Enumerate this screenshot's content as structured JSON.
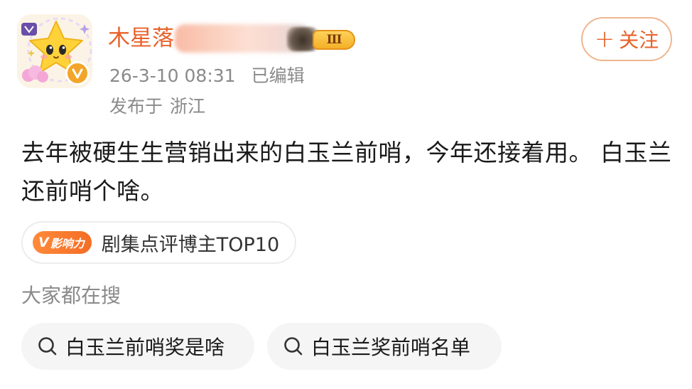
{
  "author": {
    "name_visible": "木星落",
    "level_badge": "III",
    "avatar_icon": "star-mascot-avatar",
    "verified_icon": "verified-v-icon"
  },
  "meta": {
    "timestamp": "26-3-10 08:31",
    "edited": "已编辑",
    "location_prefix": "发布于",
    "location": "浙江"
  },
  "follow_button": {
    "plus": "+",
    "label": "关注"
  },
  "post": {
    "text": "去年被硬生生营销出来的白玉兰前哨，今年还接着用。 白玉兰还前哨个啥。"
  },
  "influence": {
    "pill_mark": "V",
    "pill_text": "影响力",
    "label": "剧集点评博主TOP10"
  },
  "search": {
    "heading": "大家都在搜",
    "chips": [
      {
        "label": "白玉兰前哨奖是啥"
      },
      {
        "label": "白玉兰奖前哨名单"
      }
    ]
  },
  "colors": {
    "accent_orange": "#e8622a",
    "muted_text": "#8a8a8a",
    "badge_gold": "#f2a52a",
    "chip_bg": "#f5f5f5"
  }
}
